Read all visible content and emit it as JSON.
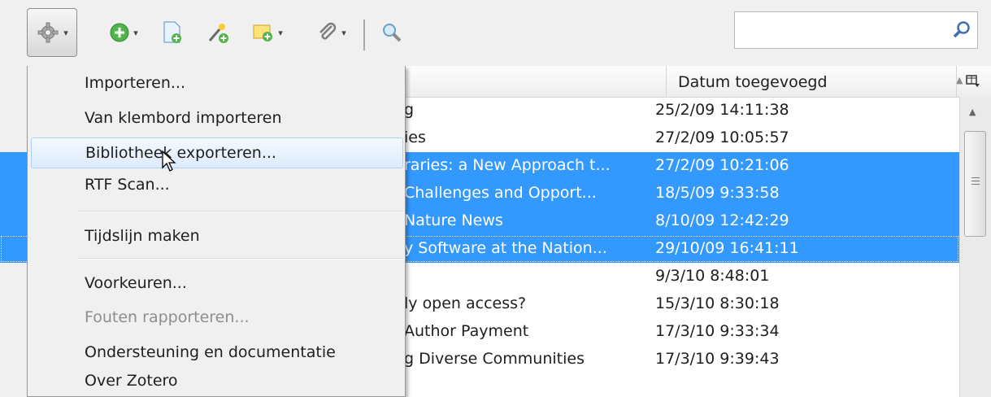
{
  "toolbar": {
    "icons": [
      "gear-icon",
      "new-item-icon",
      "new-note-document-icon",
      "wand-icon",
      "new-collection-icon",
      "attachment-icon",
      "lookup-magnifier-icon"
    ],
    "search": {
      "value": "",
      "placeholder": ""
    }
  },
  "columns": {
    "date_added": "Datum toegevoegd",
    "sort": "ascending"
  },
  "menu": {
    "items": [
      {
        "label": "Importeren...",
        "state": "normal"
      },
      {
        "label": "Van klembord importeren",
        "state": "normal"
      },
      {
        "label": "Bibliotheek exporteren...",
        "state": "hover"
      },
      {
        "label": "RTF Scan...",
        "state": "normal"
      },
      {
        "label": "Tijdslijn maken",
        "state": "normal"
      },
      {
        "label": "Voorkeuren...",
        "state": "normal"
      },
      {
        "label": "Fouten rapporteren...",
        "state": "disabled"
      },
      {
        "label": "Ondersteuning en documentatie",
        "state": "normal"
      },
      {
        "label": "Over Zotero",
        "state": "normal"
      }
    ]
  },
  "rows": [
    {
      "title": "g",
      "date": "25/2/09 14:11:38",
      "selected": false
    },
    {
      "title": "ies",
      "date": "27/2/09 10:05:57",
      "selected": false
    },
    {
      "title": "raries: a New Approach t...",
      "date": "27/2/09 10:21:06",
      "selected": true
    },
    {
      "title": " Challenges and Opport...",
      "date": "18/5/09 9:33:58",
      "selected": true
    },
    {
      "title": " Nature News",
      "date": "8/10/09 12:42:29",
      "selected": true
    },
    {
      "title": "y Software at the Nation...",
      "date": "29/10/09 16:41:11",
      "selected": true
    },
    {
      "title": "",
      "date": "9/3/10 8:48:01",
      "selected": false
    },
    {
      "title": "ly open access?",
      "date": "15/3/10 8:30:18",
      "selected": false
    },
    {
      "title": " Author Payment",
      "date": "17/3/10 9:33:34",
      "selected": false
    },
    {
      "title": "g Diverse Communities",
      "date": "17/3/10 9:39:43",
      "selected": false
    }
  ]
}
